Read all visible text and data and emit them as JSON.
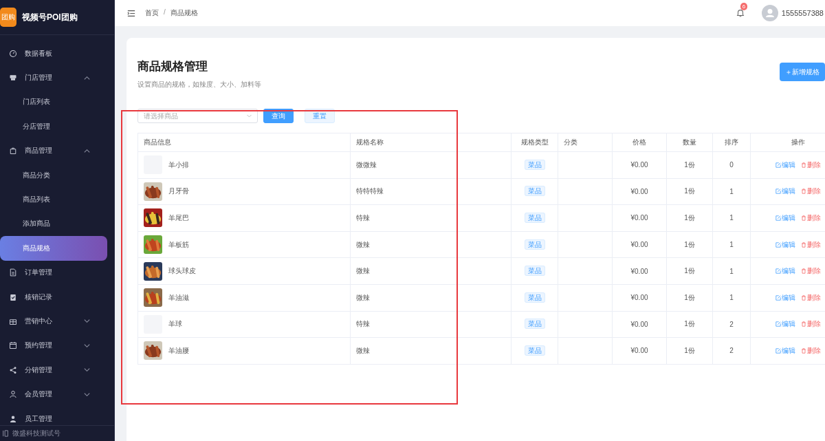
{
  "app": {
    "logo_text": "团购",
    "title": "视频号POI团购"
  },
  "sidebar": {
    "items": [
      {
        "label": "数据看板",
        "selected": false
      },
      {
        "label": "门店管理",
        "selected": false,
        "expanded": true,
        "children": [
          {
            "label": "门店列表",
            "selected": false
          },
          {
            "label": "分店管理",
            "selected": false
          }
        ]
      },
      {
        "label": "商品管理",
        "selected": false,
        "expanded": true,
        "children": [
          {
            "label": "商品分类",
            "selected": false
          },
          {
            "label": "商品列表",
            "selected": false
          },
          {
            "label": "添加商品",
            "selected": false
          },
          {
            "label": "商品规格",
            "selected": true
          }
        ]
      },
      {
        "label": "订单管理",
        "selected": false
      },
      {
        "label": "核销记录",
        "selected": false
      },
      {
        "label": "营销中心",
        "selected": false,
        "expanded": false
      },
      {
        "label": "预约管理",
        "selected": false,
        "expanded": false
      },
      {
        "label": "分销管理",
        "selected": false,
        "expanded": false
      },
      {
        "label": "会员管理",
        "selected": false,
        "expanded": false
      },
      {
        "label": "员工管理",
        "selected": false
      }
    ],
    "footer": "微盛科技测试号"
  },
  "header": {
    "breadcrumb": [
      "首页",
      "商品规格"
    ],
    "separator": "/",
    "notifications": "6",
    "user": "1555557388"
  },
  "page": {
    "title": "商品规格管理",
    "subtitle": "设置商品的规格，如辣度、大小、加料等",
    "add_button": "＋新增规格"
  },
  "filter": {
    "placeholder": "请选择商品",
    "search_button": "查询",
    "reset_button": "重置"
  },
  "table": {
    "columns": [
      "商品信息",
      "规格名称",
      "规格类型",
      "分类",
      "价格",
      "数量",
      "排序",
      "操作"
    ],
    "rows": [
      {
        "image": false,
        "name": "羊小排",
        "spec": "微微辣",
        "type": "菜品",
        "price": "¥0.00",
        "qty": "1份",
        "sort": "0",
        "edit": "编辑",
        "delete": "删除"
      },
      {
        "image": true,
        "name": "月牙骨",
        "spec": "特特特辣",
        "type": "菜品",
        "price": "¥0.00",
        "qty": "1份",
        "sort": "1",
        "edit": "编辑",
        "delete": "删除"
      },
      {
        "image": true,
        "name": "羊尾巴",
        "spec": "特辣",
        "type": "菜品",
        "price": "¥0.00",
        "qty": "1份",
        "sort": "1",
        "edit": "编辑",
        "delete": "删除"
      },
      {
        "image": true,
        "name": "羊板筋",
        "spec": "微辣",
        "type": "菜品",
        "price": "¥0.00",
        "qty": "1份",
        "sort": "1",
        "edit": "编辑",
        "delete": "删除"
      },
      {
        "image": true,
        "name": "球头球皮",
        "spec": "微辣",
        "type": "菜品",
        "price": "¥0.00",
        "qty": "1份",
        "sort": "1",
        "edit": "编辑",
        "delete": "删除"
      },
      {
        "image": true,
        "name": "羊油滋",
        "spec": "微辣",
        "type": "菜品",
        "price": "¥0.00",
        "qty": "1份",
        "sort": "1",
        "edit": "编辑",
        "delete": "删除"
      },
      {
        "image": false,
        "name": "羊球",
        "spec": "特辣",
        "type": "菜品",
        "price": "¥0.00",
        "qty": "1份",
        "sort": "2",
        "edit": "编辑",
        "delete": "删除"
      },
      {
        "image": true,
        "name": "羊油腰",
        "spec": "微辣",
        "type": "菜品",
        "price": "¥0.00",
        "qty": "1份",
        "sort": "2",
        "edit": "编辑",
        "delete": "删除"
      }
    ]
  }
}
